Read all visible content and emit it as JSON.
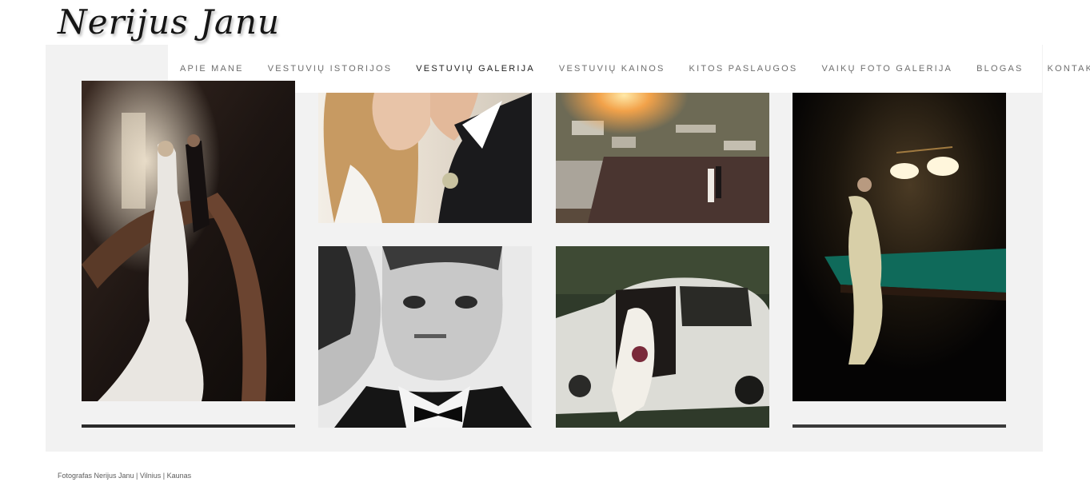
{
  "brand": {
    "logo_text": "Nerijus Janu"
  },
  "nav": {
    "items": [
      {
        "label": "APIE MANE",
        "active": false
      },
      {
        "label": "VESTUVIŲ ISTORIJOS",
        "active": false
      },
      {
        "label": "VESTUVIŲ GALERIJA",
        "active": true
      },
      {
        "label": "VESTUVIŲ KAINOS",
        "active": false
      },
      {
        "label": "KITOS PASLAUGOS",
        "active": false
      },
      {
        "label": "VAIKŲ FOTO GALERIJA",
        "active": false
      },
      {
        "label": "BLOGAS",
        "active": false
      },
      {
        "label": "KONTAKTAI",
        "active": false
      }
    ]
  },
  "gallery": {
    "photos": [
      {
        "subject": "bride-staircase-photo"
      },
      {
        "subject": "couple-closeup-photo"
      },
      {
        "subject": "rooftop-sunset-photo"
      },
      {
        "subject": "bride-billiard-room-photo"
      },
      {
        "subject": "groom-portrait-bw-photo"
      },
      {
        "subject": "bride-vintage-car-photo"
      }
    ]
  },
  "footer": {
    "text": "Fotografas Nerijus Janu | Vilnius | Kaunas"
  },
  "colors": {
    "gallery_background": "#f2f2f2",
    "nav_text": "#6e6e6e",
    "nav_active": "#1e1e1e"
  }
}
